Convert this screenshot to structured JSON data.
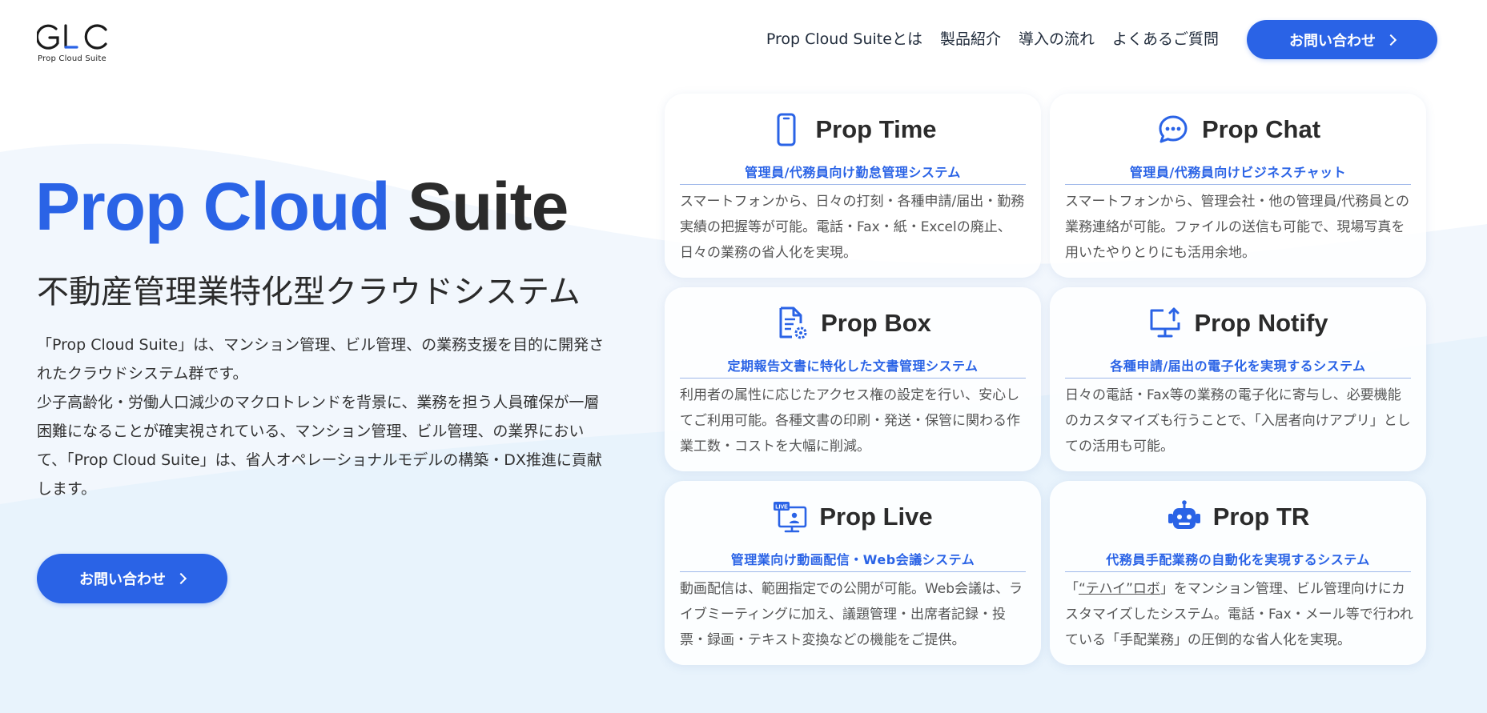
{
  "brand": {
    "logo_text": "GLC",
    "logo_subtitle": "Prop Cloud Suite",
    "accent": "#2a63e6"
  },
  "nav": {
    "items": [
      "Prop Cloud Suiteとは",
      "製品紹介",
      "導入の流れ",
      "よくあるご質問"
    ],
    "cta_label": "お問い合わせ"
  },
  "hero": {
    "title_blue": "Prop Cloud",
    "title_dark": "Suite",
    "subtitle": "不動産管理業特化型クラウドシステム",
    "desc_1": "「Prop Cloud Suite」は、マンション管理、ビル管理、の業務支援を目的に開発されたクラウドシステム群です。",
    "desc_2": "少子高齢化・労働人口減少のマクロトレンドを背景に、業務を担う人員確保が一層困難になることが確実視されている、マンション管理、ビル管理、の業界において、「Prop Cloud Suite」は、省人オペレーショナルモデルの構築・DX推進に貢献します。",
    "cta_label": "お問い合わせ"
  },
  "products": [
    {
      "title": "Prop Time",
      "icon": "smartphone-icon",
      "tagline": "管理員/代務員向け勤怠管理システム",
      "text": "スマートフォンから、日々の打刻・各種申請/届出・勤務実績の把握等が可能。電話・Fax・紙・Excelの廃止、日々の業務の省人化を実現。"
    },
    {
      "title": "Prop Chat",
      "icon": "chat-bubble-icon",
      "tagline": "管理員/代務員向けビジネスチャット",
      "text": "スマートフォンから、管理会社・他の管理員/代務員との業務連絡が可能。ファイルの送信も可能で、現場写真を用いたやりとりにも活用余地。"
    },
    {
      "title": "Prop Box",
      "icon": "document-gear-icon",
      "tagline": "定期報告文書に特化した文書管理システム",
      "text": "利用者の属性に応じたアクセス権の設定を行い、安心してご利用可能。各種文書の印刷・発送・保管に関わる作業工数・コストを大幅に削減。"
    },
    {
      "title": "Prop Notify",
      "icon": "monitor-upload-icon",
      "tagline": "各種申請/届出の電子化を実現するシステム",
      "text": "日々の電話・Fax等の業務の電子化に寄与し、必要機能のカスタマイズも行うことで、「入居者向けアプリ」としての活用も可能。"
    },
    {
      "title": "Prop Live",
      "icon": "live-stream-icon",
      "icon_badge": "LIVE",
      "tagline": "管理業向け動画配信・Web会議システム",
      "text": "動画配信は、範囲指定での公開が可能。Web会議は、ライブミーティングに加え、議題管理・出席者記録・投票・録画・テキスト変換などの機能をご提供。"
    },
    {
      "title": "Prop TR",
      "icon": "robot-icon",
      "tagline": "代務員手配業務の自動化を実現するシステム",
      "text_link": "“テハイ”ロボ",
      "text_before": "「",
      "text_after": "」をマンション管理、ビル管理向けにカスタマイズしたシステム。電話・Fax・メール等で行われている「手配業務」の圧倒的な省人化を実現。"
    }
  ]
}
